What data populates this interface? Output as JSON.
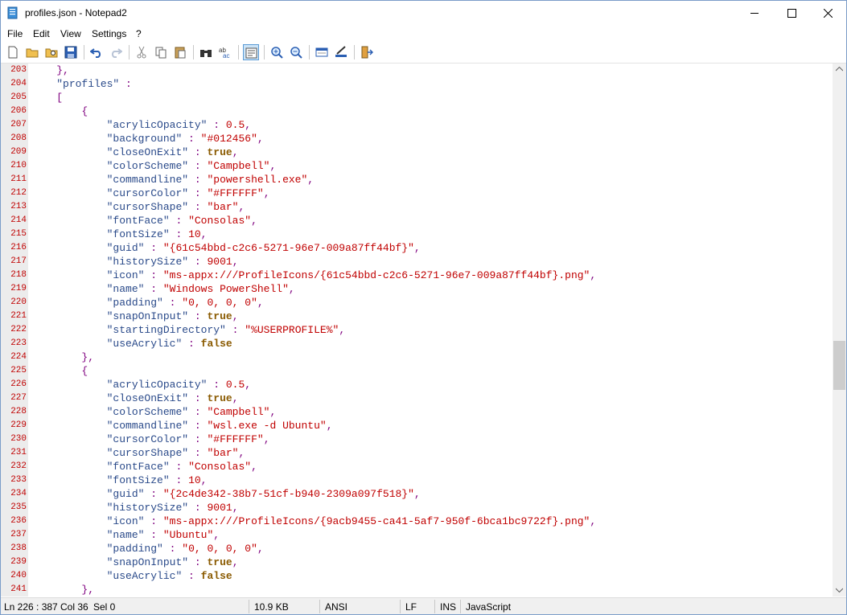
{
  "window": {
    "title": "profiles.json - Notepad2"
  },
  "menu": [
    "File",
    "Edit",
    "View",
    "Settings",
    "?"
  ],
  "toolbar": {
    "icons": [
      "new-file-icon",
      "open-file-icon",
      "browse-icon",
      "save-icon",
      "undo-icon",
      "redo-icon",
      "cut-icon",
      "copy-icon",
      "paste-icon",
      "find-icon",
      "replace-icon",
      "word-wrap-icon",
      "zoom-in-icon",
      "zoom-out-icon",
      "scheme-icon",
      "customize-icon",
      "exit-icon"
    ]
  },
  "editor": {
    "lines": [
      {
        "n": "203",
        "code": "    },"
      },
      {
        "n": "204",
        "code": "    \"profiles\" :"
      },
      {
        "n": "205",
        "code": "    ["
      },
      {
        "n": "206",
        "code": "        {"
      },
      {
        "n": "207",
        "code": "            \"acrylicOpacity\" : 0.5,"
      },
      {
        "n": "208",
        "code": "            \"background\" : \"#012456\","
      },
      {
        "n": "209",
        "code": "            \"closeOnExit\" : true,"
      },
      {
        "n": "210",
        "code": "            \"colorScheme\" : \"Campbell\","
      },
      {
        "n": "211",
        "code": "            \"commandline\" : \"powershell.exe\","
      },
      {
        "n": "212",
        "code": "            \"cursorColor\" : \"#FFFFFF\","
      },
      {
        "n": "213",
        "code": "            \"cursorShape\" : \"bar\","
      },
      {
        "n": "214",
        "code": "            \"fontFace\" : \"Consolas\","
      },
      {
        "n": "215",
        "code": "            \"fontSize\" : 10,"
      },
      {
        "n": "216",
        "code": "            \"guid\" : \"{61c54bbd-c2c6-5271-96e7-009a87ff44bf}\","
      },
      {
        "n": "217",
        "code": "            \"historySize\" : 9001,"
      },
      {
        "n": "218",
        "code": "            \"icon\" : \"ms-appx:///ProfileIcons/{61c54bbd-c2c6-5271-96e7-009a87ff44bf}.png\","
      },
      {
        "n": "219",
        "code": "            \"name\" : \"Windows PowerShell\","
      },
      {
        "n": "220",
        "code": "            \"padding\" : \"0, 0, 0, 0\","
      },
      {
        "n": "221",
        "code": "            \"snapOnInput\" : true,"
      },
      {
        "n": "222",
        "code": "            \"startingDirectory\" : \"%USERPROFILE%\","
      },
      {
        "n": "223",
        "code": "            \"useAcrylic\" : false"
      },
      {
        "n": "224",
        "code": "        },"
      },
      {
        "n": "225",
        "code": "        {"
      },
      {
        "n": "226",
        "code": "            \"acrylicOpacity\" : 0.5,"
      },
      {
        "n": "227",
        "code": "            \"closeOnExit\" : true,"
      },
      {
        "n": "228",
        "code": "            \"colorScheme\" : \"Campbell\","
      },
      {
        "n": "229",
        "code": "            \"commandline\" : \"wsl.exe -d Ubuntu\","
      },
      {
        "n": "230",
        "code": "            \"cursorColor\" : \"#FFFFFF\","
      },
      {
        "n": "231",
        "code": "            \"cursorShape\" : \"bar\","
      },
      {
        "n": "232",
        "code": "            \"fontFace\" : \"Consolas\","
      },
      {
        "n": "233",
        "code": "            \"fontSize\" : 10,"
      },
      {
        "n": "234",
        "code": "            \"guid\" : \"{2c4de342-38b7-51cf-b940-2309a097f518}\","
      },
      {
        "n": "235",
        "code": "            \"historySize\" : 9001,"
      },
      {
        "n": "236",
        "code": "            \"icon\" : \"ms-appx:///ProfileIcons/{9acb9455-ca41-5af7-950f-6bca1bc9722f}.png\","
      },
      {
        "n": "237",
        "code": "            \"name\" : \"Ubuntu\","
      },
      {
        "n": "238",
        "code": "            \"padding\" : \"0, 0, 0, 0\","
      },
      {
        "n": "239",
        "code": "            \"snapOnInput\" : true,"
      },
      {
        "n": "240",
        "code": "            \"useAcrylic\" : false"
      },
      {
        "n": "241",
        "code": "        },"
      }
    ]
  },
  "status": {
    "position": "Ln 226 : 387",
    "column": "Col 36",
    "selection": "Sel 0",
    "size": "10.9 KB",
    "encoding": "ANSI",
    "line_ending": "LF",
    "insert_mode": "INS",
    "language": "JavaScript"
  },
  "colors": {
    "line_number": "#c00000",
    "string": "#c00000",
    "bool": "#8a5a00",
    "punct": "#7f007f"
  }
}
